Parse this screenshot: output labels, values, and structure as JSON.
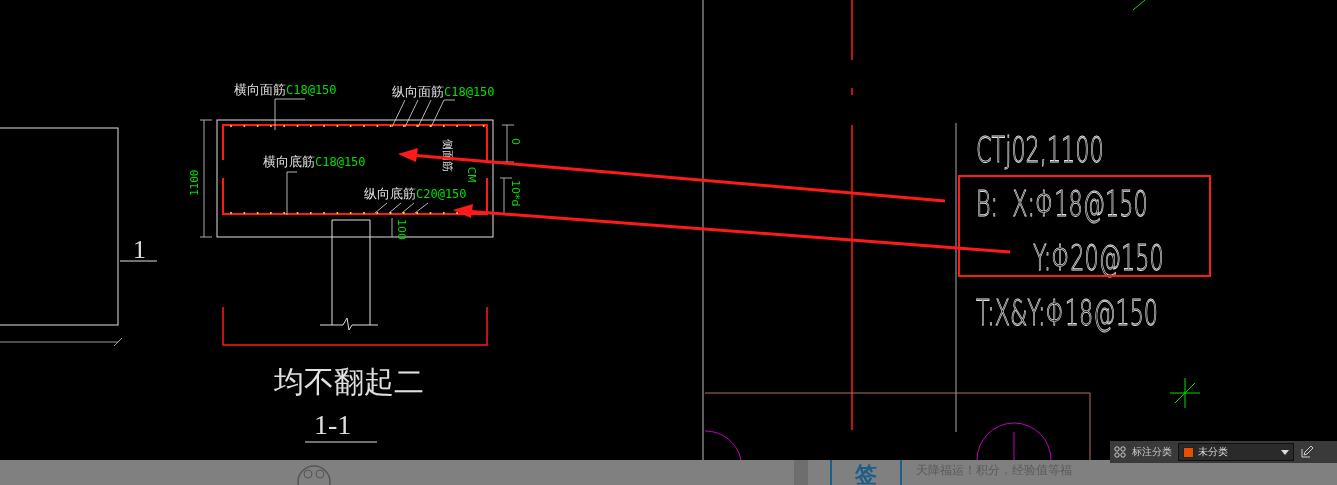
{
  "section": {
    "title": "均不翻起二",
    "number": "1-1",
    "marker": "1",
    "height_dim": "1100",
    "rebar_labels": [
      {
        "name": "横向面筋",
        "spec": "C18@150"
      },
      {
        "name": "纵向面筋",
        "spec": "C18@150"
      },
      {
        "name": "横向底筋",
        "spec": "C18@150"
      },
      {
        "name": "纵向底筋",
        "spec": "C20@150"
      }
    ],
    "side_label": "侧面筋",
    "side_spec": "CM",
    "dims": [
      "0",
      "10*d",
      "100"
    ]
  },
  "annotation": {
    "lines": [
      "CTj02,1100",
      "B:  X:Φ18@150",
      "Y:Φ20@150",
      "T:X&Y:Φ18@150"
    ]
  },
  "toolbar": {
    "label": "标注分类",
    "dropdown": {
      "value": "未分类",
      "color": "#e65100"
    }
  },
  "banner": {
    "badge": "签",
    "text": "天降福运！积分，经验值等福"
  }
}
